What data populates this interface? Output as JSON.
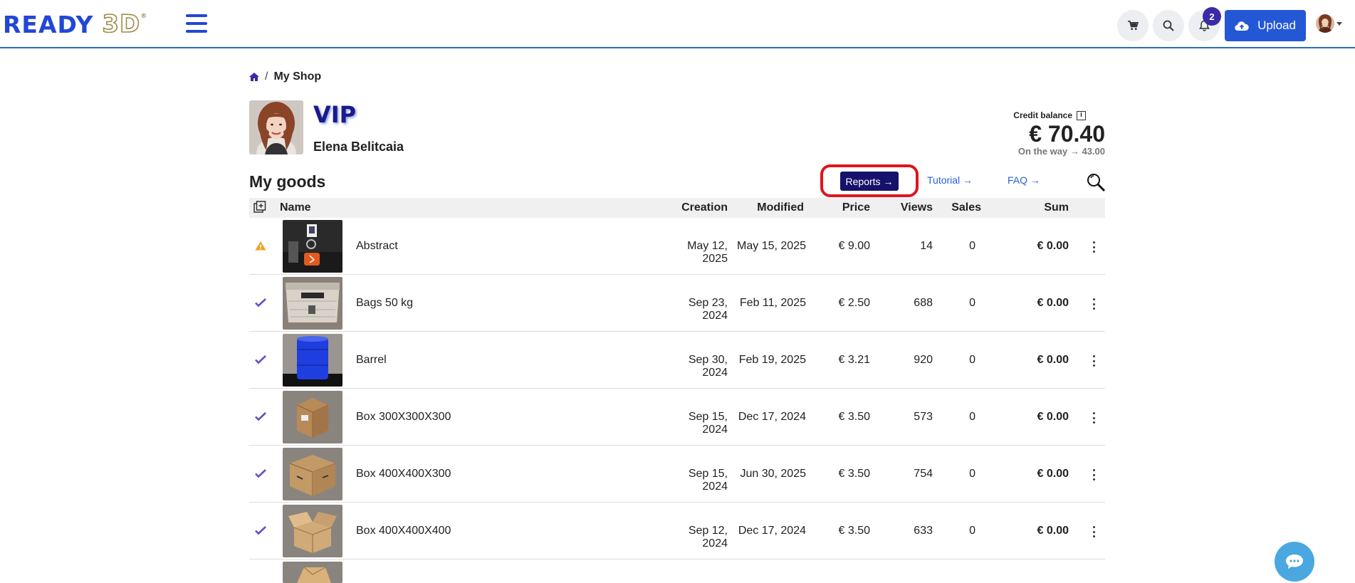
{
  "header": {
    "logo_text_1": "READY",
    "logo_text_2": "3D",
    "logo_reg": "®",
    "notification_count": "2",
    "upload_label": "Upload",
    "icons": [
      "menu-icon",
      "cart-icon",
      "search-icon",
      "bell-icon",
      "cloud-upload-icon",
      "avatar",
      "caret-down-icon"
    ]
  },
  "breadcrumb": {
    "home_icon": "home-icon",
    "separator": "/",
    "current": "My Shop"
  },
  "profile": {
    "level": "VIP",
    "name": "Elena Belitcaia"
  },
  "credit": {
    "label": "Credit balance",
    "info_icon": "info-icon",
    "value": "€ 70.40",
    "on_the_way": "On the way → 43.00"
  },
  "goods": {
    "title": "My goods",
    "reports_label": "Reports →",
    "tutorial_label": "Tutorial →",
    "faq_label": "FAQ →",
    "highlight_color": "#e0141c",
    "columns": {
      "name": "Name",
      "creation": "Creation",
      "modified": "Modified",
      "price": "Price",
      "views": "Views",
      "sales": "Sales",
      "sum": "Sum"
    },
    "rows": [
      {
        "status": "warning",
        "name": "Abstract",
        "creation": "May 12, 2025",
        "modified": "May 15, 2025",
        "price": "€ 9.00",
        "views": "14",
        "sales": "0",
        "sum": "€ 0.00"
      },
      {
        "status": "ok",
        "name": "Bags 50 kg",
        "creation": "Sep 23, 2024",
        "modified": "Feb 11, 2025",
        "price": "€ 2.50",
        "views": "688",
        "sales": "0",
        "sum": "€ 0.00"
      },
      {
        "status": "ok",
        "name": "Barrel",
        "creation": "Sep 30, 2024",
        "modified": "Feb 19, 2025",
        "price": "€ 3.21",
        "views": "920",
        "sales": "0",
        "sum": "€ 0.00"
      },
      {
        "status": "ok",
        "name": "Box 300X300X300",
        "creation": "Sep 15, 2024",
        "modified": "Dec 17, 2024",
        "price": "€ 3.50",
        "views": "573",
        "sales": "0",
        "sum": "€ 0.00"
      },
      {
        "status": "ok",
        "name": "Box 400X400X300",
        "creation": "Sep 15, 2024",
        "modified": "Jun 30, 2025",
        "price": "€ 3.50",
        "views": "754",
        "sales": "0",
        "sum": "€ 0.00"
      },
      {
        "status": "ok",
        "name": "Box 400X400X400",
        "creation": "Sep 12, 2024",
        "modified": "Dec 17, 2024",
        "price": "€ 3.50",
        "views": "633",
        "sales": "0",
        "sum": "€ 0.00"
      }
    ]
  },
  "chat": {
    "icon": "chat-icon"
  }
}
